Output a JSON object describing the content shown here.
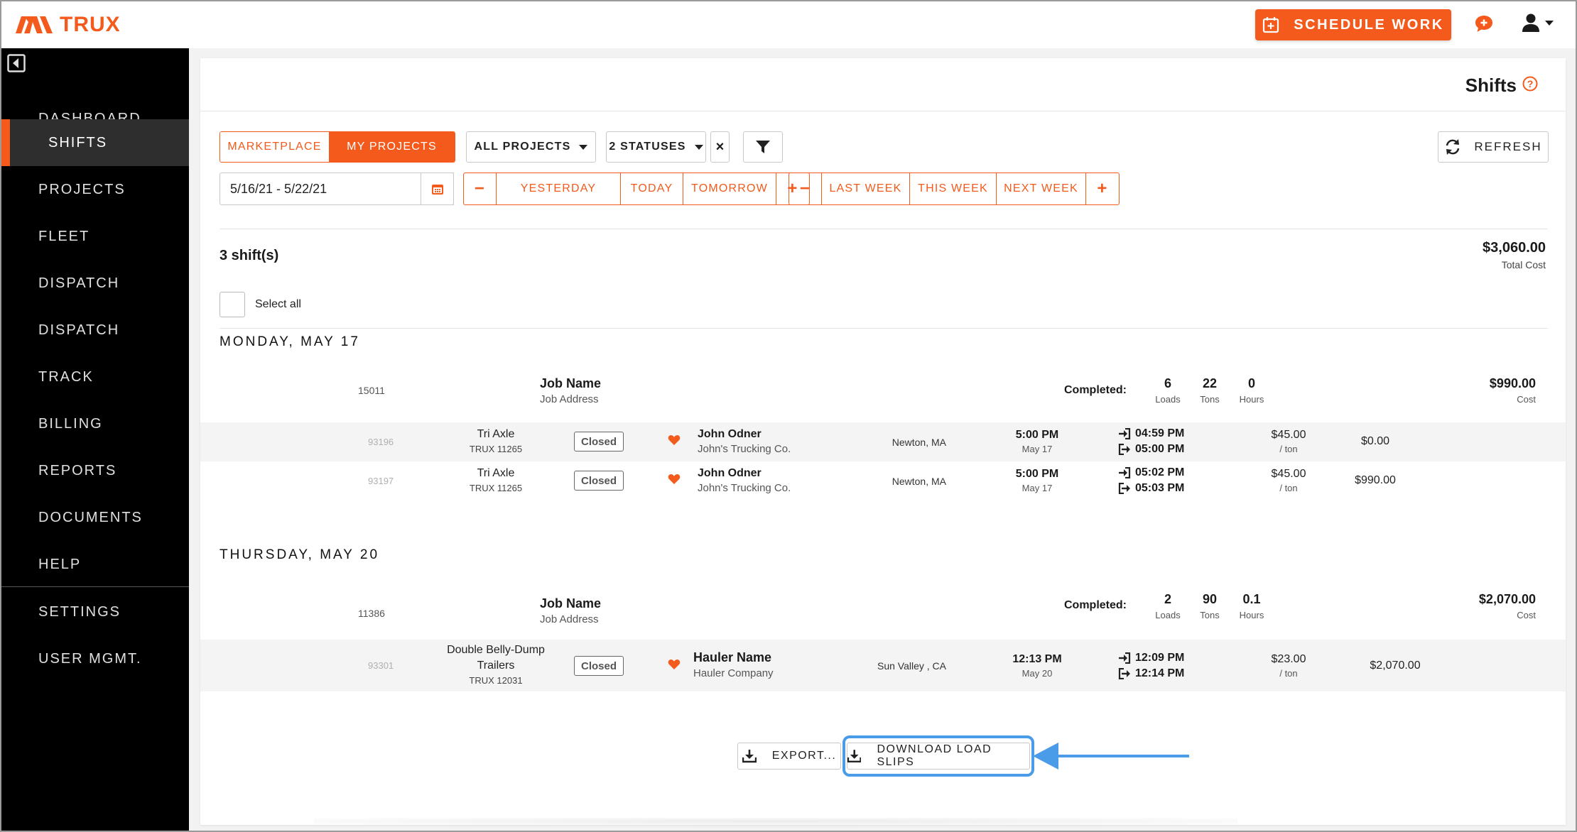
{
  "brand": {
    "name": "TRUX",
    "accent": "#f35a1b",
    "highlight": "#4a9be8"
  },
  "header": {
    "schedule_label": "SCHEDULE WORK",
    "icons": [
      "calendar-plus-icon",
      "chat-icon",
      "user-icon",
      "chevron-down-icon"
    ]
  },
  "sidebar": {
    "items": [
      {
        "label": "DASHBOARD",
        "active": false
      },
      {
        "label": "SHIFTS",
        "active": true
      },
      {
        "label": "PROJECTS",
        "active": false
      },
      {
        "label": "FLEET",
        "active": false
      },
      {
        "label": "DISPATCH",
        "active": false
      },
      {
        "label": "DISPATCH",
        "active": false
      },
      {
        "label": "TRACK",
        "active": false
      },
      {
        "label": "BILLING",
        "active": false
      },
      {
        "label": "REPORTS",
        "active": false
      },
      {
        "label": "DOCUMENTS",
        "active": false
      },
      {
        "label": "HELP",
        "active": false
      },
      {
        "label": "SETTINGS",
        "active": false
      },
      {
        "label": "USER MGMT.",
        "active": false
      }
    ]
  },
  "page": {
    "title": "Shifts"
  },
  "toolbar": {
    "tabs": [
      {
        "label": "MARKETPLACE",
        "active": false
      },
      {
        "label": "MY PROJECTS",
        "active": true
      }
    ],
    "projects_filter": "ALL PROJECTS",
    "status_filter": "2 STATUSES",
    "clear_label": "×",
    "refresh_label": "REFRESH",
    "date_range": "5/16/21  -  5/22/21",
    "day_nav": [
      "−",
      "YESTERDAY",
      "TODAY",
      "TOMORROW",
      "+"
    ],
    "week_nav": [
      "−",
      "LAST WEEK",
      "THIS WEEK",
      "NEXT WEEK",
      "+"
    ]
  },
  "summary": {
    "count": "3 shift(s)",
    "total_value": "$3,060.00",
    "total_label": "Total Cost",
    "select_all": "Select all"
  },
  "days": [
    {
      "heading": "MONDAY, MAY 17",
      "job": {
        "id": "15011",
        "name": "Job Name",
        "address": "Job Address",
        "completed_label": "Completed:",
        "loads": "6",
        "loads_label": "Loads",
        "tons": "22",
        "tons_label": "Tons",
        "hours": "0",
        "hours_label": "Hours",
        "cost": "$990.00",
        "cost_label": "Cost"
      },
      "shifts": [
        {
          "id": "93196",
          "truck": "Tri Axle",
          "truck_id": "TRUX 11265",
          "status": "Closed",
          "hauler": "John Odner",
          "company": "John's Trucking Co.",
          "location": "Newton, MA",
          "time": "5:00 PM",
          "date": "May 17",
          "in": "04:59 PM",
          "out": "05:00 PM",
          "rate": "$45.00",
          "rate_unit": "/ ton",
          "amount": "$0.00"
        },
        {
          "id": "93197",
          "truck": "Tri Axle",
          "truck_id": "TRUX 11265",
          "status": "Closed",
          "hauler": "John Odner",
          "company": "John's Trucking Co.",
          "location": "Newton, MA",
          "time": "5:00 PM",
          "date": "May 17",
          "in": "05:02 PM",
          "out": "05:03 PM",
          "rate": "$45.00",
          "rate_unit": "/ ton",
          "amount": "$990.00"
        }
      ]
    },
    {
      "heading": "THURSDAY, MAY 20",
      "job": {
        "id": "11386",
        "name": "Job Name",
        "address": "Job Address",
        "completed_label": "Completed:",
        "loads": "2",
        "loads_label": "Loads",
        "tons": "90",
        "tons_label": "Tons",
        "hours": "0.1",
        "hours_label": "Hours",
        "cost": "$2,070.00",
        "cost_label": "Cost"
      },
      "shifts": [
        {
          "id": "93301",
          "truck_line1": "Double Belly-Dump",
          "truck_line2": "Trailers",
          "truck_id": "TRUX 12031",
          "status": "Closed",
          "hauler": "Hauler Name",
          "company": "Hauler Company",
          "location": "Sun Valley , CA",
          "time": "12:13 PM",
          "date": "May 20",
          "in": "12:09 PM",
          "out": "12:14 PM",
          "rate": "$23.00",
          "rate_unit": "/ ton",
          "amount": "$2,070.00"
        }
      ]
    }
  ],
  "actions": {
    "export_label": "EXPORT...",
    "download_label": "DOWNLOAD LOAD SLIPS"
  }
}
